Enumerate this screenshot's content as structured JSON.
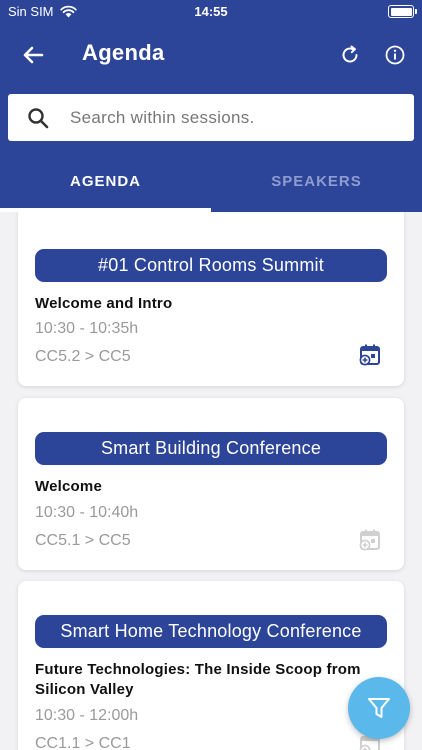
{
  "status": {
    "carrier": "Sin SIM",
    "time": "14:55"
  },
  "header": {
    "title": "Agenda"
  },
  "search": {
    "placeholder": "Search within sessions."
  },
  "tabs": [
    {
      "label": "AGENDA"
    },
    {
      "label": "SPEAKERS"
    }
  ],
  "sessions": [
    {
      "track": "#01 Control Rooms Summit",
      "title": "Welcome and Intro",
      "time": "10:30 - 10:35h",
      "room": "CC5.2 > CC5"
    },
    {
      "track": "Smart Building Conference",
      "title": "Welcome",
      "time": "10:30 - 10:40h",
      "room": "CC5.1 > CC5"
    },
    {
      "track": "Smart Home Technology Conference",
      "title": "Future Technologies: The Inside Scoop from Silicon Valley",
      "time": "10:30 - 12:00h",
      "room": "CC1.1 > CC1"
    }
  ],
  "colors": {
    "header": "#2d4598",
    "fab": "#5bb8ea",
    "muted": "#9a9a9a",
    "calendar_active": "#2d4598",
    "calendar_inactive": "#d0d0d0"
  }
}
